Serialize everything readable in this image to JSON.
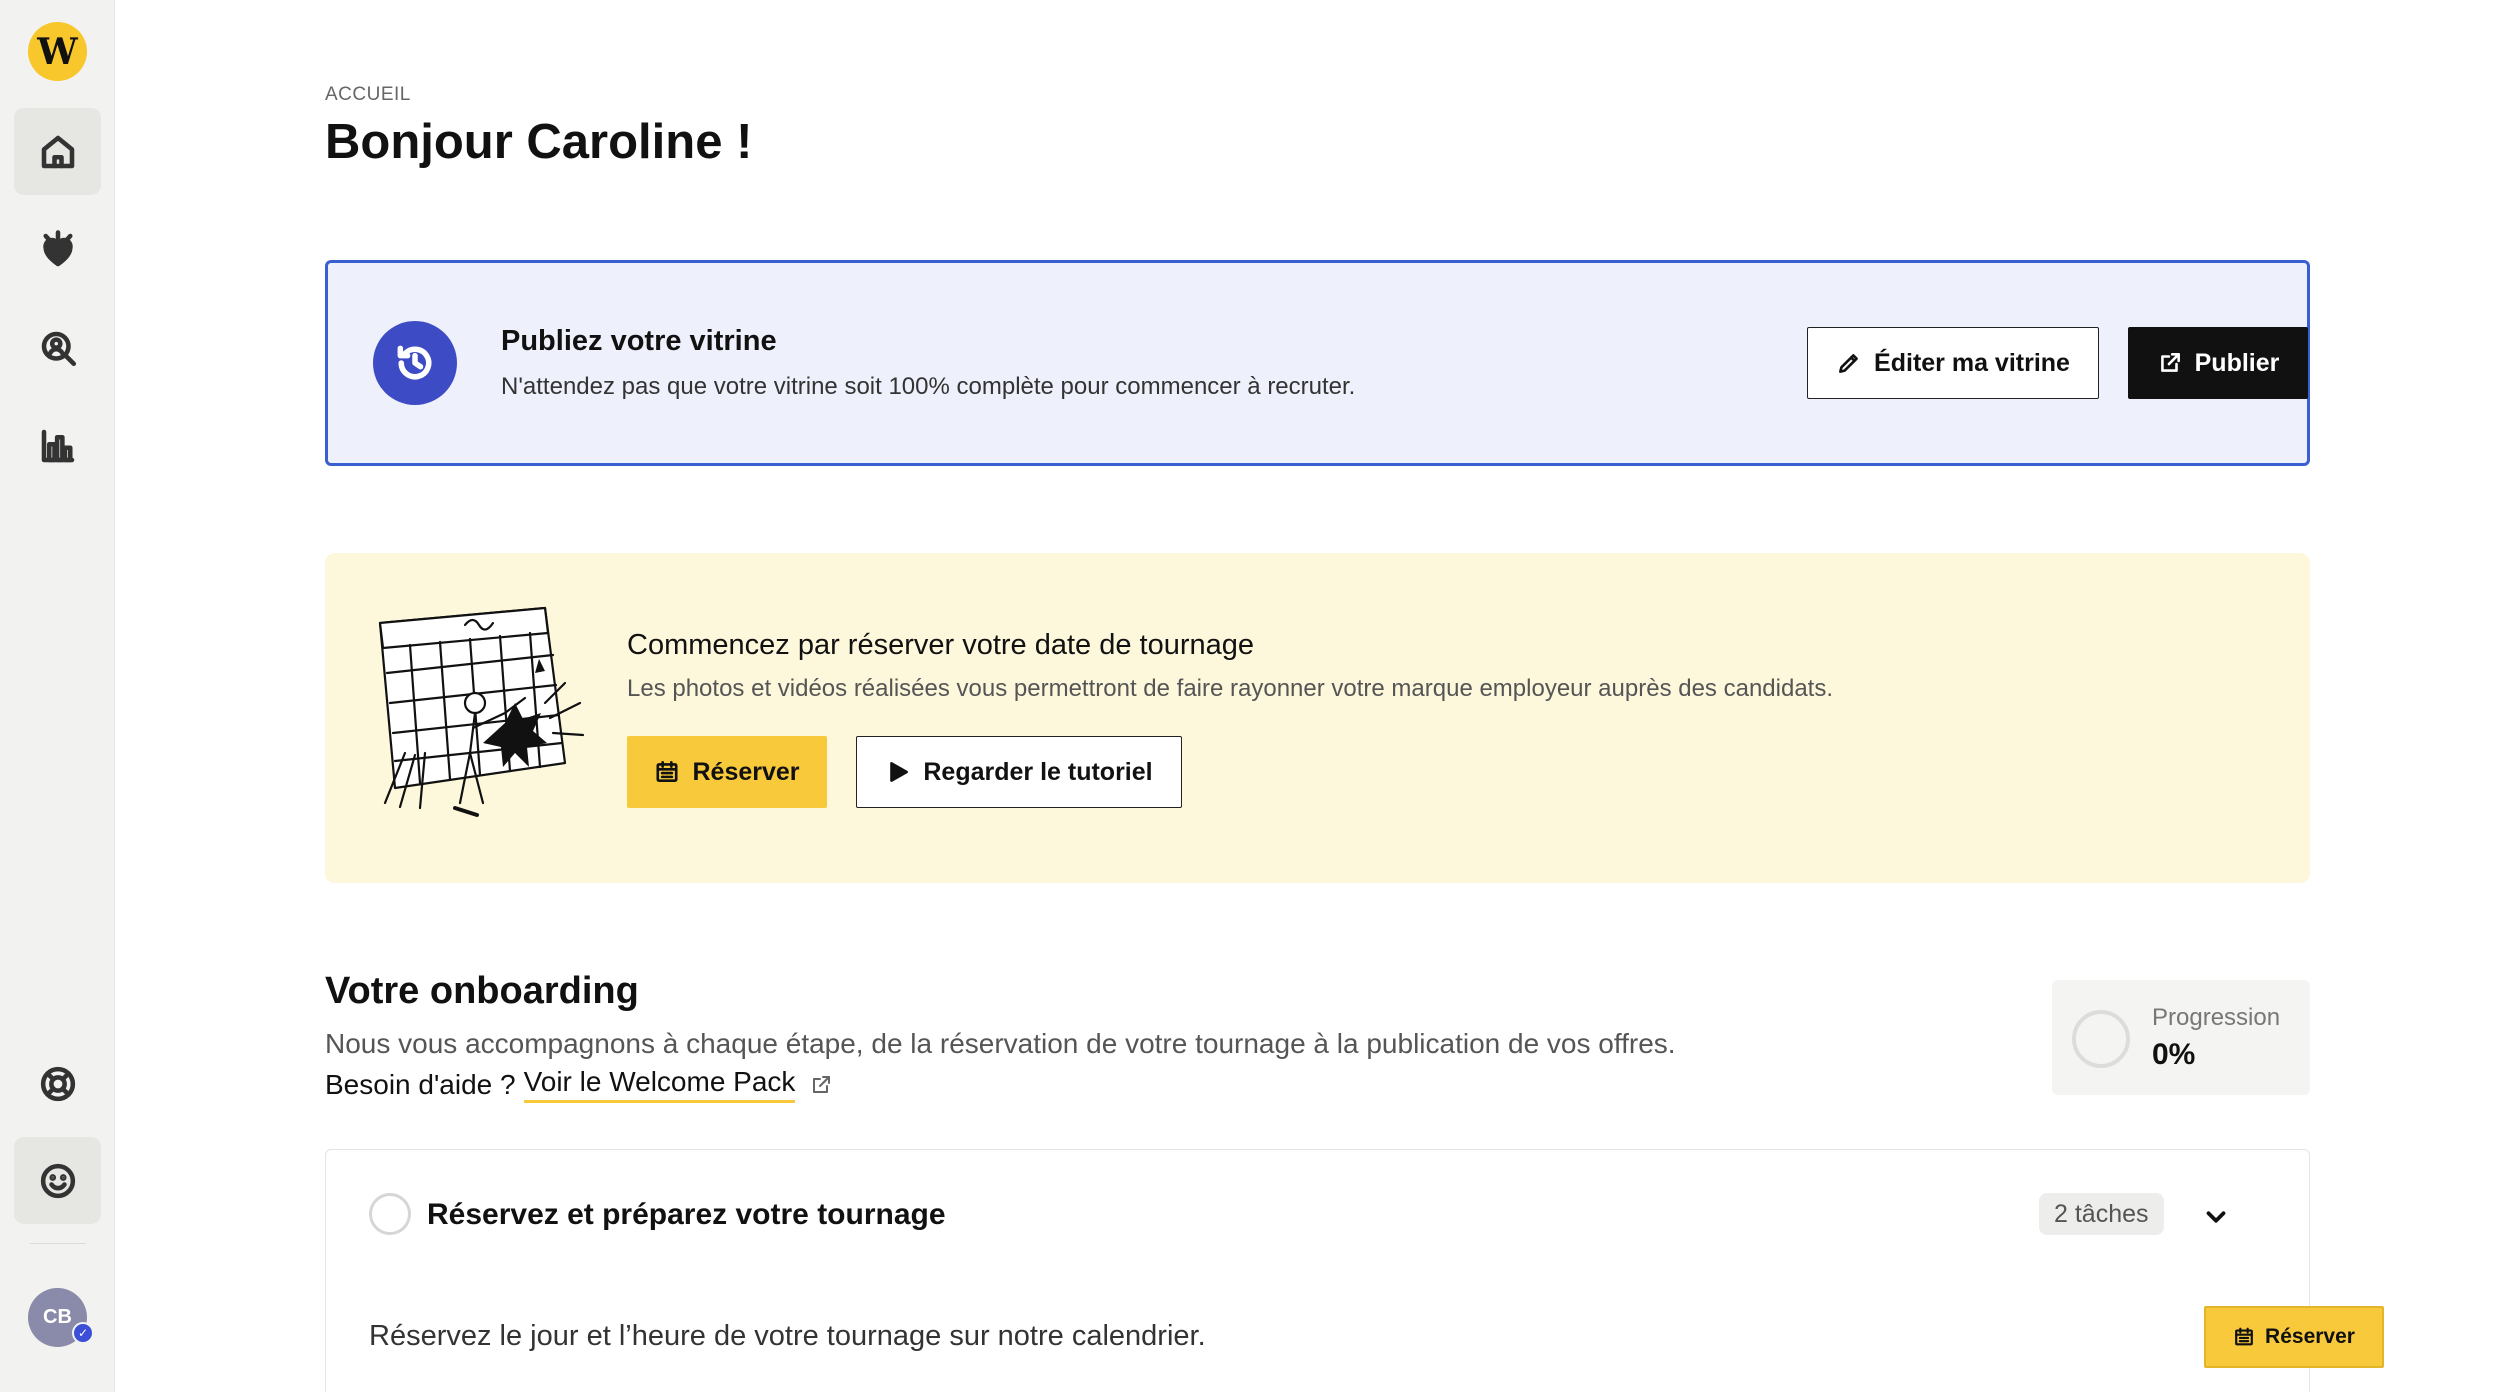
{
  "sidebar": {
    "logo_letter": "W",
    "items": [
      {
        "name": "home",
        "icon": "home-icon",
        "active": true
      },
      {
        "name": "favorites",
        "icon": "heart-sparkle-icon",
        "active": false
      },
      {
        "name": "candidates",
        "icon": "person-search-icon",
        "active": false
      },
      {
        "name": "statistics",
        "icon": "bar-chart-icon",
        "active": false
      }
    ],
    "bottom_items": [
      {
        "name": "help",
        "icon": "lifebuoy-icon"
      },
      {
        "name": "feedback",
        "icon": "smiley-icon"
      }
    ],
    "avatar_initials": "CB"
  },
  "header": {
    "breadcrumb": "ACCUEIL",
    "title": "Bonjour Caroline !"
  },
  "publish_banner": {
    "title": "Publiez votre vitrine",
    "text": "N'attendez pas que votre vitrine soit 100% complète pour commencer à recruter.",
    "edit_label": "Éditer ma vitrine",
    "publish_label": "Publier",
    "accent_color": "#3a5fd0"
  },
  "tournage_card": {
    "title": "Commencez par réserver votre date de tournage",
    "text": "Les photos et vidéos réalisées vous permettront de faire rayonner votre marque employeur auprès des candidats.",
    "reserve_label": "Réserver",
    "tutorial_label": "Regarder le tutoriel",
    "background_color": "#fdf7dc"
  },
  "onboarding": {
    "title": "Votre onboarding",
    "description": "Nous vous accompagnons à chaque étape, de la réservation de votre tournage à la publication de vos offres.",
    "help_prefix": "Besoin d'aide ?",
    "help_link": "Voir le Welcome Pack",
    "progress_label": "Progression",
    "progress_value": "0%",
    "progress_fraction": 0,
    "task_group": {
      "title": "Réservez et préparez votre tournage",
      "badge": "2 tâches",
      "subtask_text": "Réservez le jour et l’heure de votre tournage sur notre calendrier.",
      "subtask_button": "Réserver"
    }
  },
  "colors": {
    "brand_yellow": "#f7c93b",
    "brand_blue": "#3d4bc4",
    "dark_button": "#111111"
  }
}
